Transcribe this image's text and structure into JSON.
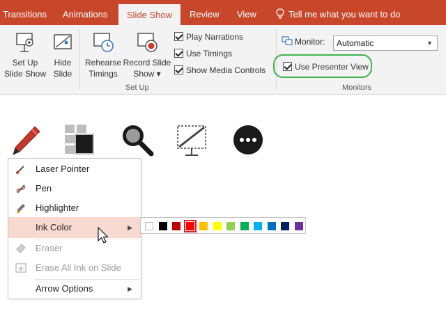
{
  "tabs": [
    {
      "label": "Transitions",
      "active": false
    },
    {
      "label": "Animations",
      "active": false
    },
    {
      "label": "Slide Show",
      "active": true
    },
    {
      "label": "Review",
      "active": false
    },
    {
      "label": "View",
      "active": false
    }
  ],
  "tell_me": "Tell me what you want to do",
  "ribbon": {
    "setup_slideshow": [
      "Set Up",
      "Slide Show"
    ],
    "hide_slide": [
      "Hide",
      "Slide"
    ],
    "rehearse_timings": [
      "Rehearse",
      "Timings"
    ],
    "record_slideshow": [
      "Record Slide",
      "Show ▾"
    ],
    "checkboxes": [
      {
        "label": "Play Narrations",
        "checked": true
      },
      {
        "label": "Use Timings",
        "checked": true
      },
      {
        "label": "Show Media Controls",
        "checked": true
      }
    ],
    "setup_group_label": "Set Up",
    "monitor_label": "Monitor:",
    "monitor_value": "Automatic",
    "presenter_view": {
      "label": "Use Presenter View",
      "checked": true
    },
    "monitors_group_label": "Monitors"
  },
  "toolbar_icons": [
    "pen-tool-icon",
    "see-all-slides-icon",
    "zoom-icon",
    "black-screen-icon",
    "more-options-icon"
  ],
  "menu": {
    "items": [
      {
        "label": "Laser Pointer",
        "icon": "laser-pointer-icon",
        "disabled": false,
        "submenu": false
      },
      {
        "label": "Pen",
        "icon": "pen-icon",
        "disabled": false,
        "submenu": false
      },
      {
        "label": "Highlighter",
        "icon": "highlighter-icon",
        "disabled": false,
        "submenu": false
      },
      {
        "label": "Ink Color",
        "icon": "",
        "disabled": false,
        "submenu": true
      },
      {
        "label": "Eraser",
        "icon": "eraser-icon",
        "disabled": true,
        "submenu": false
      },
      {
        "label": "Erase All Ink on Slide",
        "icon": "erase-all-icon",
        "disabled": true,
        "submenu": false
      },
      {
        "label": "Arrow Options",
        "icon": "",
        "disabled": false,
        "submenu": true
      }
    ]
  },
  "ink_colors": [
    "#ffffff",
    "#000000",
    "#c00000",
    "#ff0000",
    "#ffc000",
    "#ffff00",
    "#92d050",
    "#00b050",
    "#00b0f0",
    "#0070c0",
    "#002060",
    "#7030a0"
  ],
  "selected_ink_color": "#ff0000",
  "colors": {
    "accent": "#c8472b",
    "highlight_ring": "#3fb24a",
    "menu_hover": "#f7d9cf"
  }
}
